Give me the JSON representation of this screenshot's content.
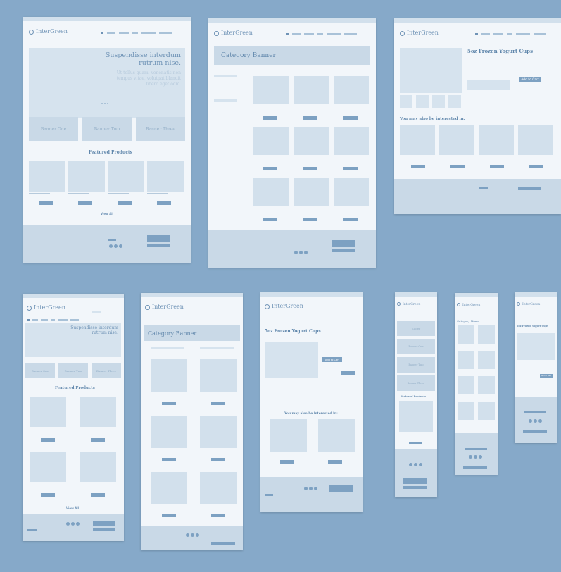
{
  "brand": "InterGreen",
  "hero": {
    "title": "Suspendisse interdum rutrum nise.",
    "subtitle": "Ut tellus quam, venenatis non tempus vitae, volutpat blandit libero eget odio."
  },
  "banners": [
    "Banner One",
    "Banner Two",
    "Banner Three"
  ],
  "mobile_banners": [
    "Slider",
    "Banner One",
    "Banner Two",
    "Banner Three"
  ],
  "featured_title": "Featured Products",
  "view_all": "View All",
  "category_banner": "Category Banner",
  "category_name": "Category Name",
  "product_title": "5oz Frozen Yogurt Cups",
  "add_to_cart": "Add to Cart",
  "interested_title": "You may also be interested in:",
  "footer": {
    "follow": "FOLLOW US",
    "payment": "PAYMENT",
    "newsletter": "GET OUR NEWSLETTER"
  },
  "colors": {
    "background": "#86a9c9",
    "board": "#f2f6fa",
    "accent": "#7da1c2",
    "light": "#d6e3ee"
  }
}
